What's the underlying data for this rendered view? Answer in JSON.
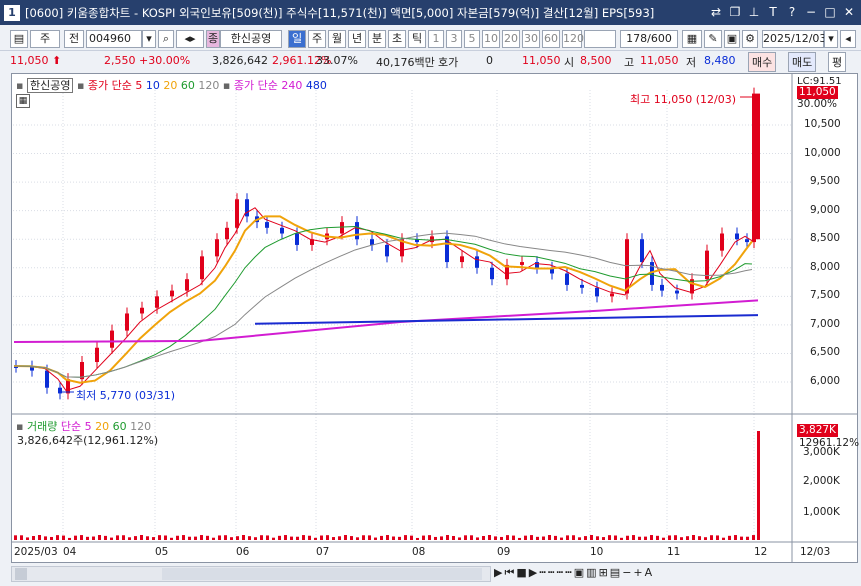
{
  "window": {
    "num": "1",
    "title": "[0600] 키움종합차트 - KOSPI 외국인보유[509(천)] 주식수[11,571(천)] 액면[5,000] 자본금[579(억)] 결산[12월] EPS[593]"
  },
  "toolbar": {
    "type": "주",
    "all": "전",
    "code": "004960",
    "name_badge": "종",
    "name": "한신공영",
    "periods": [
      "일",
      "주",
      "월",
      "년",
      "분",
      "초",
      "틱"
    ],
    "intervals": [
      "1",
      "3",
      "5",
      "10",
      "20",
      "30",
      "60",
      "120"
    ],
    "count": "178/600",
    "date": "2025/12/03"
  },
  "quote": {
    "price": "11,050",
    "change": "2,550 +30.00%",
    "volume": "3,826,642",
    "vol_rate": "2,961.12%",
    "turnover": "33.07%",
    "amount": "40,176백만",
    "hoga_label": "호가",
    "hoga_value": "0",
    "hoga_price": "11,050",
    "open_label": "시",
    "open": "8,500",
    "high_label": "고",
    "high": "11,050",
    "low_label": "저",
    "low": "8,480",
    "buy": "매수",
    "sell": "매도",
    "avg": "평"
  },
  "legend": {
    "stock": "한신공영",
    "ma_label": "종가 단순 5",
    "ma_10": "10",
    "ma_20": "20",
    "ma_60": "60",
    "ma_120": "120",
    "ma240": "종가 단순 240",
    "ma480": "480",
    "vol_label": "거래량",
    "vol_ma": "단순 5",
    "vol_20": "20",
    "vol_60": "60",
    "vol_120": "120",
    "vol_value": "3,826,642주(12,961.12%)"
  },
  "annotations": {
    "high": "최고 11,050 (12/03)",
    "low": "최저 5,770 (03/31)",
    "tag_price": "11,050",
    "tag_pct": "30.00%",
    "tag_lc": "LC:91.51",
    "tag_vol": "3,827K",
    "tag_vol_pct": "12961.12%"
  },
  "yaxis": [
    "10,500",
    "10,000",
    "9,500",
    "9,000",
    "8,500",
    "8,000",
    "7,500",
    "7,000",
    "6,500",
    "6,000"
  ],
  "vaxis": [
    "3,000K",
    "2,000K",
    "1,000K"
  ],
  "xaxis": [
    "2025/03",
    "04",
    "05",
    "06",
    "07",
    "08",
    "09",
    "10",
    "11",
    "12",
    "12/03"
  ],
  "colors": {
    "up": "#e0001b",
    "down": "#0a2dd6",
    "ma5": "#e0001b",
    "ma20": "#f0a30a",
    "ma60": "#1f9b2f",
    "ma120": "#888888",
    "ma240": "#d21cd2"
  }
}
